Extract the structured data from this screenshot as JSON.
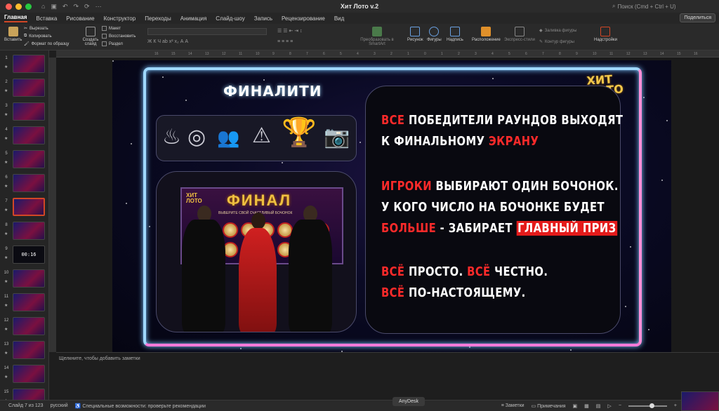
{
  "window": {
    "title": "Хит Лото v.2",
    "search_placeholder": "Поиск (Cmd + Ctrl + U)"
  },
  "menu": {
    "tabs": [
      "Главная",
      "Вставка",
      "Рисование",
      "Конструктор",
      "Переходы",
      "Анимация",
      "Слайд-шоу",
      "Запись",
      "Рецензирование",
      "Вид"
    ],
    "active": "Главная",
    "share": "Поделиться"
  },
  "ribbon": {
    "paste": "Вставить",
    "cut": "Вырезать",
    "copy": "Копировать",
    "format_painter": "Формат по образцу",
    "new_slide": "Создать слайд",
    "layout": "Макет",
    "reset": "Восстановить",
    "section": "Раздел",
    "smartart": "Преобразовать в SmartArt",
    "picture": "Рисунок",
    "shapes": "Фигуры",
    "textbox": "Надпись",
    "arrange": "Расположение",
    "quick_styles": "Экспресс-стили",
    "shape_fill": "Заливка фигуры",
    "shape_outline": "Контур фигуры",
    "addins": "Надстройки"
  },
  "ruler_marks": [
    "16",
    "15",
    "14",
    "13",
    "12",
    "11",
    "10",
    "9",
    "8",
    "7",
    "6",
    "5",
    "4",
    "3",
    "2",
    "1",
    "0",
    "1",
    "2",
    "3",
    "4",
    "5",
    "6",
    "7",
    "8",
    "9",
    "10",
    "11",
    "12",
    "13",
    "14",
    "15",
    "16"
  ],
  "thumbnails": [
    {
      "num": "1",
      "label": ""
    },
    {
      "num": "2",
      "label": ""
    },
    {
      "num": "3",
      "label": ""
    },
    {
      "num": "4",
      "label": ""
    },
    {
      "num": "5",
      "label": ""
    },
    {
      "num": "6",
      "label": ""
    },
    {
      "num": "7",
      "label": ""
    },
    {
      "num": "8",
      "label": ""
    },
    {
      "num": "9",
      "label": "00:16"
    },
    {
      "num": "10",
      "label": ""
    },
    {
      "num": "11",
      "label": ""
    },
    {
      "num": "12",
      "label": ""
    },
    {
      "num": "13",
      "label": ""
    },
    {
      "num": "14",
      "label": ""
    },
    {
      "num": "15",
      "label": ""
    }
  ],
  "selected_slide": "7",
  "slide": {
    "heading": "ФИНАЛИТИ",
    "logo_line1": "ХИТ",
    "logo_line2": "ЛОТО",
    "tv_logo_line1": "ХИТ",
    "tv_logo_line2": "ЛОТО",
    "tv_title": "ФИНАЛ",
    "tv_subtitle": "ВЫБЕРИТЕ СВОЙ СЧАСТЛИВЫЙ БОЧОНОК",
    "lines": {
      "l1_red": "ВСЕ",
      "l1_rest": " ПОБЕДИТЕЛИ РАУНДОВ ВЫХОДЯТ",
      "l2_a": "К ФИНАЛЬНОМУ ",
      "l2_red": "ЭКРАНУ",
      "l3_red": "ИГРОКИ",
      "l3_rest": " ВЫБИРАЮТ ОДИН БОЧОНОК.",
      "l4": "У КОГО ЧИСЛО НА БОЧОНКЕ БУДЕТ",
      "l5_red": "БОЛЬШЕ",
      "l5_mid": " - ЗАБИРАЕТ ",
      "l5_hl": "ГЛАВНЫЙ ПРИЗ",
      "l6_red1": "ВСЁ",
      "l6_mid": " ПРОСТО. ",
      "l6_red2": "ВСЁ",
      "l6_rest": " ЧЕСТНО.",
      "l7_red": "ВСЁ",
      "l7_rest": " ПО-НАСТОЯЩЕМУ."
    }
  },
  "notes_placeholder": "Щелкните, чтобы добавить заметки",
  "status": {
    "slide_of": "Слайд 7 из 123",
    "language": "русский",
    "accessibility": "Специальные возможности: проверьте рекомендации",
    "anydesk": "AnyDesk",
    "notes": "Заметки",
    "comments": "Примечания"
  }
}
